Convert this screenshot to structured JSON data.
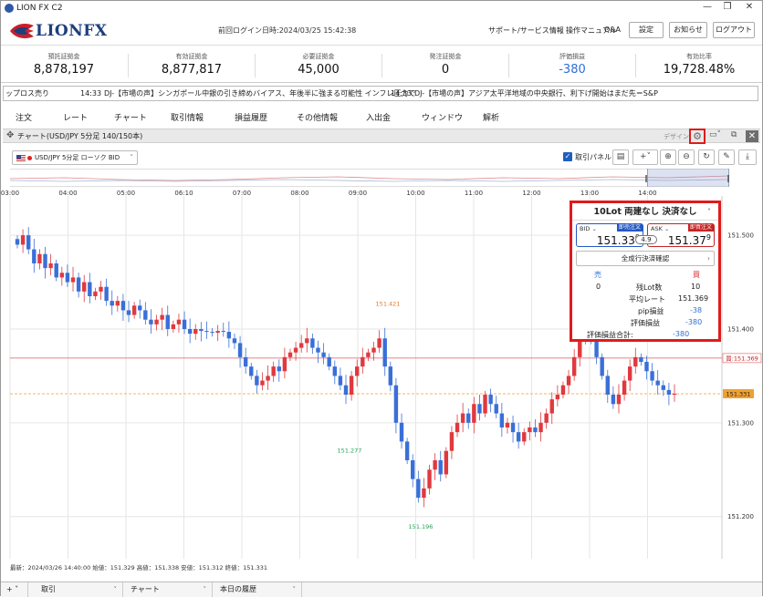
{
  "app": {
    "title": "LION FX C2",
    "brand": "LIONFX",
    "last_login": "前回ログイン日時:2024/03/25 15:42:38"
  },
  "header": {
    "links": [
      "サポート/サービス情報",
      "操作マニュアル",
      "Q&A"
    ],
    "buttons": [
      "設定",
      "お知らせ",
      "ログアウト"
    ]
  },
  "summary": [
    {
      "label": "預託証拠金",
      "value": "8,878,197"
    },
    {
      "label": "有効証拠金",
      "value": "8,877,817"
    },
    {
      "label": "必要証拠金",
      "value": "45,000"
    },
    {
      "label": "発注証拠金",
      "value": "0"
    },
    {
      "label": "評価損益",
      "value": "-380"
    },
    {
      "label": "有効比率",
      "value": "19,728.48%"
    }
  ],
  "ticker": {
    "left_fragment": "ップロス売り",
    "item1_time": "14:33",
    "item1_text": "DJ-【市場の声】シンガポール中銀の引き締めバイアス、年後半に強まる可能性 インフレ圧力で",
    "item2_time": "14:33",
    "item2_text": "DJ-【市場の声】アジア太平洋地域の中央銀行、利下げ開始はまだ先＝S&P"
  },
  "menu": [
    "注文",
    "レート",
    "チャート",
    "取引情報",
    "損益履歴",
    "その他情報",
    "入出金",
    "ウィンドウ",
    "解析"
  ],
  "chart_panel": {
    "title": "チャート(USD/JPY 5分足 140/150本)",
    "design_label": "デザイン",
    "symbol_select": "USD/JPY 5分足 ローソク BID",
    "trade_panel_checkbox": "取引パネル",
    "footer_info": "最新：2024/03/26 14:40:00 始値：151.329 高値：151.338 安値：151.312 終値：151.331"
  },
  "trade_panel": {
    "header": "10Lot 両建なし 決済なし",
    "bid_label": "BID",
    "bid_tag": "即売注文",
    "bid_main": "151.33",
    "bid_pip": "0",
    "ask_label": "ASK",
    "ask_tag": "即買注文",
    "ask_main": "151.37",
    "ask_pip": "9",
    "spread": "4.9",
    "all_settle": "全成行決済確認",
    "sell_header": "売",
    "buy_header": "買",
    "sell_lots": "0",
    "rows": [
      {
        "label": "残Lot数",
        "value": "10"
      },
      {
        "label": "平均レート",
        "value": "151.369"
      },
      {
        "label": "pip損益",
        "value": "-38"
      },
      {
        "label": "評価損益",
        "value": "-380"
      }
    ],
    "total_label": "評価損益合計:",
    "total_value": "-380"
  },
  "bottom_tabs": [
    "取引",
    "チャート",
    "本日の履歴"
  ],
  "colors": {
    "up": "#e0393e",
    "down": "#3a6fd8",
    "bid_line": "#e05a5a",
    "ask_line": "#f0a030",
    "accent": "#e01b1b"
  },
  "chart_data": {
    "type": "candlestick",
    "x_ticks": [
      "03:00",
      "04:00",
      "05:00",
      "06:10",
      "07:00",
      "08:00",
      "09:00",
      "10:00",
      "11:00",
      "12:00",
      "13:00",
      "14:00"
    ],
    "y_ticks": [
      "151.500",
      "151.400",
      "151.300",
      "151.200"
    ],
    "ylim": [
      151.155,
      151.54
    ],
    "price_labels": {
      "bid_line": "買:151.369",
      "current": "151.331"
    },
    "annotations": [
      {
        "text": "151.421",
        "time": "08:40",
        "value": 151.421,
        "color": "#e07a2a"
      },
      {
        "text": "151.277",
        "time": "09:00",
        "value": 151.277,
        "color": "#2aa05a"
      },
      {
        "text": "151.196",
        "time": "10:25",
        "value": 151.196,
        "color": "#2aa05a"
      }
    ],
    "current_price": 151.331,
    "position_price": 151.369,
    "closes": [
      151.49,
      151.5,
      151.485,
      151.47,
      151.48,
      151.465,
      151.47,
      151.455,
      151.46,
      151.45,
      151.455,
      151.44,
      151.45,
      151.435,
      151.44,
      151.445,
      151.43,
      151.425,
      151.43,
      151.42,
      151.415,
      151.425,
      151.42,
      151.41,
      151.405,
      151.41,
      151.415,
      151.4,
      151.405,
      151.41,
      151.4,
      151.395,
      151.4,
      151.398,
      151.397,
      151.396,
      151.398,
      151.397,
      151.39,
      151.385,
      151.37,
      151.36,
      151.35,
      151.34,
      151.345,
      151.35,
      151.36,
      151.355,
      151.37,
      151.375,
      151.38,
      151.385,
      151.39,
      151.38,
      151.375,
      151.37,
      151.36,
      151.35,
      151.34,
      151.33,
      151.35,
      151.36,
      151.37,
      151.375,
      151.38,
      151.39,
      151.36,
      151.34,
      151.3,
      151.28,
      151.26,
      151.24,
      151.22,
      151.23,
      151.25,
      151.26,
      151.245,
      151.27,
      151.29,
      151.3,
      151.31,
      151.3,
      151.32,
      151.31,
      151.33,
      151.32,
      151.31,
      151.295,
      151.3,
      151.29,
      151.28,
      151.29,
      151.295,
      151.29,
      151.3,
      151.31,
      151.325,
      151.33,
      151.34,
      151.35,
      151.37,
      151.39,
      151.4,
      151.395,
      151.37,
      151.35,
      151.33,
      151.32,
      151.33,
      151.345,
      151.36,
      151.37,
      151.365,
      151.355,
      151.345,
      151.34,
      151.335,
      151.33,
      151.331
    ]
  }
}
